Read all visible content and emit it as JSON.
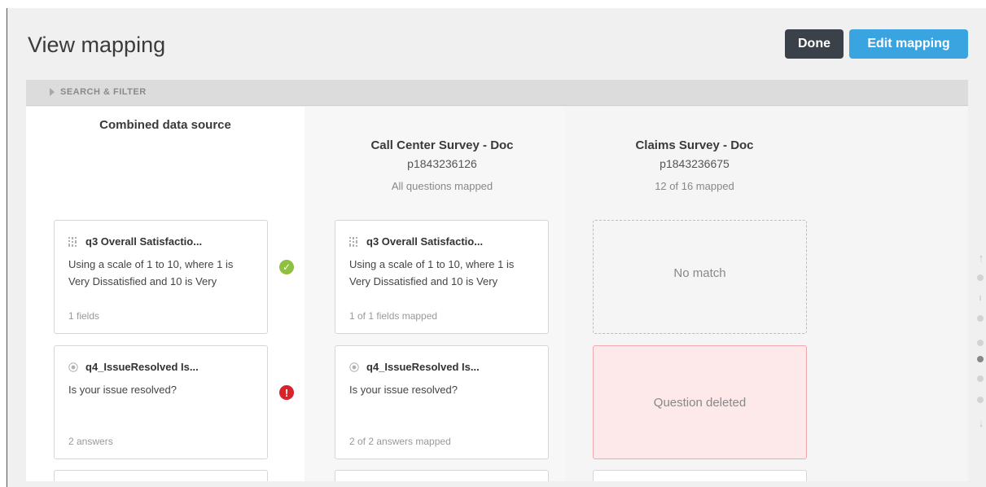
{
  "header": {
    "title": "View mapping",
    "done_label": "Done",
    "edit_label": "Edit mapping"
  },
  "filter": {
    "label": "SEARCH & FILTER"
  },
  "columns": {
    "combined": {
      "name": "Combined data source"
    },
    "source1": {
      "name": "Call Center Survey - Doc",
      "id": "p1843236126",
      "status": "All questions mapped"
    },
    "source2": {
      "name": "Claims Survey - Doc",
      "id": "p1843236675",
      "status": "12 of 16 mapped"
    }
  },
  "rows": [
    {
      "combined": {
        "icon": "matrix-icon",
        "title": "q3 Overall Satisfactio...",
        "text": "Using a scale of 1 to 10, where 1 is Very Dissatisfied and 10 is Very",
        "meta": "1 fields"
      },
      "status": "ok",
      "status_glyph": "✓",
      "source1": {
        "icon": "matrix-icon",
        "title": "q3 Overall Satisfactio...",
        "text": "Using a scale of 1 to 10, where 1 is Very Dissatisfied and 10 is Very",
        "meta": "1 of 1 fields mapped"
      },
      "source2": {
        "label": "No match"
      }
    },
    {
      "combined": {
        "icon": "radio-icon",
        "title": "q4_IssueResolved Is...",
        "text": "Is your issue resolved?",
        "meta": "2 answers"
      },
      "status": "error",
      "status_glyph": "!",
      "source1": {
        "icon": "radio-icon",
        "title": "q4_IssueResolved Is...",
        "text": "Is your issue resolved?",
        "meta": "2 of 2 answers mapped"
      },
      "source2": {
        "label": "Question deleted"
      }
    }
  ],
  "scroller": {
    "up_glyph": "↑",
    "down_glyph": "↓"
  },
  "colors": {
    "done_button": "#3b4149",
    "edit_button": "#3aa4e1",
    "status_ok": "#8dc13f",
    "status_error": "#d8232a",
    "deleted_bg": "#fde8ea"
  }
}
